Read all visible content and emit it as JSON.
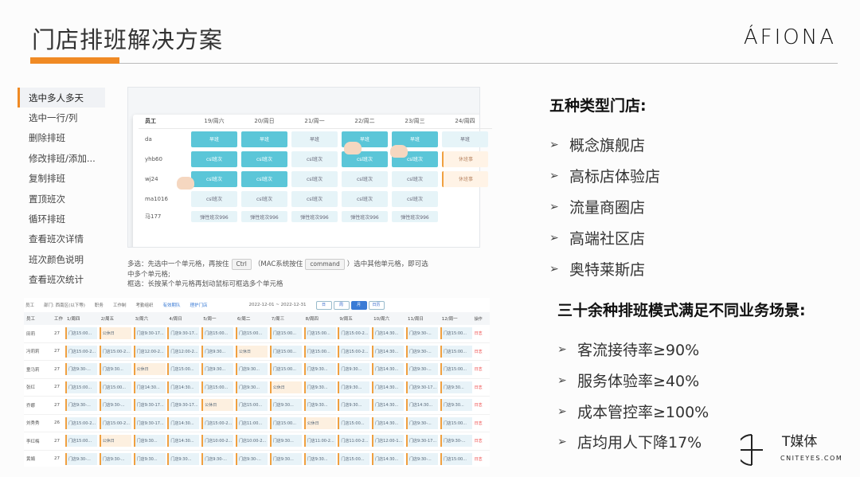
{
  "header": {
    "title": "门店排班解决方案",
    "logo": "ÁFIONA"
  },
  "sidebar": {
    "items": [
      {
        "label": "选中多人多天",
        "active": true
      },
      {
        "label": "选中一行/列"
      },
      {
        "label": "删除排班"
      },
      {
        "label": "修改排班/添加..."
      },
      {
        "label": "复制排班"
      },
      {
        "label": "置顶班次"
      },
      {
        "label": "循环排班"
      },
      {
        "label": "查看班次详情"
      },
      {
        "label": "班次颜色说明"
      },
      {
        "label": "查看班次统计"
      }
    ]
  },
  "screenshot_top": {
    "header_row": [
      "员工",
      "19/周六",
      "20/周日",
      "21/周一",
      "22/周二",
      "23/周三",
      "24/周四"
    ],
    "rows": [
      {
        "name": "da",
        "cells": [
          "早班",
          "早班",
          "早班",
          "早班",
          "早班",
          "早班"
        ]
      },
      {
        "name": "yhb60",
        "cells": [
          "csl班次",
          "csl班次",
          "csl班次",
          "csl班次",
          "csl班次",
          "休班事"
        ]
      },
      {
        "name": "wj24",
        "cells": [
          "csl班次",
          "csl班次",
          "csl班次",
          "csl班次",
          "csl班次",
          "休班事"
        ]
      },
      {
        "name": "ma1016",
        "cells": [
          "csl班次",
          "csl班次",
          "csl班次",
          "csl班次",
          "csl班次",
          ""
        ]
      },
      {
        "name": "马177",
        "cells": [
          "弹性班次996",
          "弹性班次996",
          "弹性班次996",
          "弹性班次996",
          "弹性班次996",
          "弹性班次"
        ]
      }
    ]
  },
  "caption": {
    "line1_a": "多选：先选中一个单元格，再按住",
    "key_ctrl": "Ctrl",
    "line1_b": "（MAC系统按住",
    "key_command": "command",
    "line1_c": "）选中其他单元格，即可选",
    "line2": "中多个单元格;",
    "line3": "框选：长按某个单元格再划动鼠标可框选多个单元格"
  },
  "screenshot_bottom": {
    "toolbar": [
      "员工",
      "部门: 西南区(以下等)",
      "职务",
      "工作制",
      "考勤组织",
      "有效期队",
      "理护门店"
    ],
    "date_range": "2022-12-01 ~ 2022-12-31",
    "view_buttons": [
      "日",
      "周",
      "月",
      "日历"
    ],
    "columns": [
      "员工",
      "工作",
      "1/周四",
      "2/周五",
      "3/周六",
      "4/周日",
      "5/周一",
      "6/周二",
      "7/周三",
      "8/周四",
      "9/周五",
      "10/周六",
      "11/周日",
      "12/周一",
      "操作"
    ],
    "rows": [
      {
        "name": "田莉",
        "num": "27",
        "cells": [
          "门店15:00...",
          "公休日",
          "门店9:30-17...",
          "门店9:30-17...",
          "门店15:00...",
          "门店15:00...",
          "门店15:00...",
          "门店15:00...",
          "门店15:00-2...",
          "门店14:30...",
          "门店9:30-...",
          "门店15:00..."
        ],
        "op": "日志"
      },
      {
        "name": "冯莉莉",
        "num": "27",
        "cells": [
          "门店15:00-2...",
          "门店15:00-2...",
          "门店12:00-2...",
          "门店12:00-2...",
          "门店9:30...",
          "公休日",
          "门店15:00...",
          "门店15:00...",
          "门店15:00-2...",
          "门店14:30...",
          "门店9:30-...",
          "门店15:00..."
        ],
        "op": "日志"
      },
      {
        "name": "童马莉",
        "num": "27",
        "cells": [
          "门店9:30-...",
          "门店9:30...",
          "公休日",
          "门店15:00...",
          "门店9:30...",
          "门店9:30...",
          "门店15:00...",
          "门店9:30...",
          "门店9:30...",
          "门店14:30...",
          "门店9:30-...",
          "门店15:00..."
        ],
        "op": "日志"
      },
      {
        "name": "张红",
        "num": "27",
        "cells": [
          "门店15:00...",
          "门店15:00...",
          "门店14:30...",
          "门店14:30...",
          "门店15:00...",
          "门店9:30...",
          "公休日",
          "门店9:30...",
          "门店9:30...",
          "门店14:30...",
          "门店9:30-17...",
          "门店9:30..."
        ],
        "op": "日志"
      },
      {
        "name": "乔娜",
        "num": "27",
        "cells": [
          "门店9:30-...",
          "门店9:30-...",
          "门店9:30-17...",
          "门店9:30-17...",
          "公休日",
          "门店15:00...",
          "门店9:30...",
          "门店9:30...",
          "门店9:30...",
          "门店14:30...",
          "门店14:30...",
          "门店9:30..."
        ],
        "op": "日志"
      },
      {
        "name": "刘秀秀",
        "num": "26",
        "cells": [
          "门店15:00-2...",
          "门店15:00-2...",
          "门店9:30-17...",
          "门店14:30...",
          "门店15:00-2...",
          "门店11:00...",
          "门店15:00...",
          "公休日",
          "门店15:00...",
          "门店14:30...",
          "门店9:30-...",
          "门店15:00..."
        ],
        "op": "日志"
      },
      {
        "name": "李红梅",
        "num": "27",
        "cells": [
          "门店15:00...",
          "公休日",
          "门店9:30...",
          "门店14:30...",
          "门店10:00-2...",
          "门店10:00-2...",
          "门店9:30...",
          "门店11:00-2...",
          "门店11:00-2...",
          "门店12:00-1...",
          "门店9:30-17...",
          "门店9:30-..."
        ],
        "op": "日志"
      },
      {
        "name": "黄娟",
        "num": "27",
        "cells": [
          "门店9:30-...",
          "门店9:30-...",
          "门店9:30...",
          "门店9:30...",
          "门店9:30-...",
          "门店9:30-...",
          "门店9:30...",
          "门店9:30...",
          "门店15:00...",
          "门店14:30...",
          "门店9:30-...",
          "门店15:00..."
        ],
        "op": "日志"
      }
    ]
  },
  "store_types": {
    "heading": "五种类型门店:",
    "items": [
      "概念旗舰店",
      "高标店体验店",
      "流量商圈店",
      "高端社区店",
      "奥特莱斯店"
    ]
  },
  "modes": {
    "heading": "三十余种排班模式满足不同业务场景:",
    "items": [
      "客流接待率≥90%",
      "服务体验率≥40%",
      "成本管控率≥100%",
      "店均用人下降17%"
    ]
  },
  "watermark": {
    "title": "T媒体",
    "sub": "CNITEYES.COM"
  },
  "colors": {
    "accent": "#f08a24",
    "teal": "#5bc6d8"
  },
  "icons": {
    "arrow": "triangle-right-icon"
  }
}
